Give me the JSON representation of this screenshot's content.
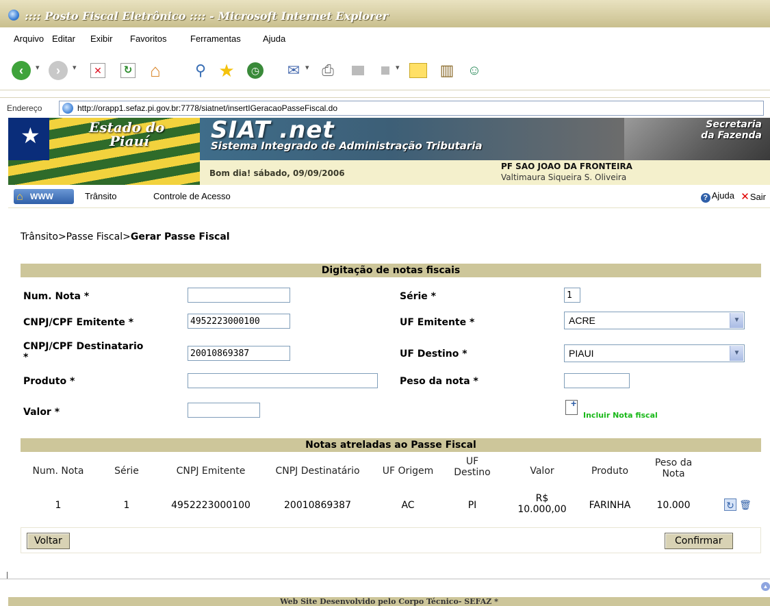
{
  "window": {
    "title": ":::: Posto Fiscal Eletrônico :::: - Microsoft Internet Explorer"
  },
  "menu": [
    "Arquivo",
    "Editar",
    "Exibir",
    "Favoritos",
    "Ferramentas",
    "Ajuda"
  ],
  "address": {
    "label": "Endereço",
    "url": "http://orapp1.sefaz.pi.gov.br:7778/siatnet/insertIGeracaoPasseFiscal.do"
  },
  "banner": {
    "estado_line1": "Estado do",
    "estado_line2": "Piauí",
    "siat_title": "SIAT .net",
    "siat_subtitle": "Sistema Integrado de Administração Tributaria",
    "secretaria_line1": "Secretaria",
    "secretaria_line2": "da Fazenda",
    "greeting": "Bom dia! sábado, 09/09/2006",
    "posto": "PF SAO JOAO DA FRONTEIRA",
    "usuario": "Valtimaura Siqueira S. Oliveira"
  },
  "nav": {
    "www": "WWW",
    "items": [
      "Trânsito",
      "Controle de Acesso"
    ],
    "ajuda": "Ajuda",
    "sair": "Sair"
  },
  "breadcrumb": {
    "path": "Trânsito>Passe Fiscal>",
    "current": "Gerar Passe Fiscal"
  },
  "form": {
    "header": "Digitação de notas fiscais",
    "num_nota_label": "Num. Nota *",
    "num_nota_value": "",
    "serie_label": "Série *",
    "serie_value": "1",
    "cnpj_emitente_label": "CNPJ/CPF Emitente *",
    "cnpj_emitente_value": "4952223000100",
    "uf_emitente_label": "UF Emitente *",
    "uf_emitente_value": "ACRE",
    "cnpj_dest_label_1": "CNPJ/CPF Destinatario",
    "cnpj_dest_label_2": "*",
    "cnpj_dest_value": "20010869387",
    "uf_destino_label": "UF Destino *",
    "uf_destino_value": "PIAUI",
    "produto_label": "Produto *",
    "produto_value": "",
    "peso_label": "Peso da nota *",
    "peso_value": "",
    "valor_label": "Valor *",
    "valor_value": "",
    "incluir_label": "Incluir Nota fiscal"
  },
  "table": {
    "header": "Notas atreladas ao Passe Fiscal",
    "columns": [
      "Num. Nota",
      "Série",
      "CNPJ Emitente",
      "CNPJ Destinatário",
      "UF Origem",
      "UF",
      "Destino",
      "Valor",
      "Produto",
      "Peso da",
      "Nota"
    ],
    "row": {
      "num_nota": "1",
      "serie": "1",
      "cnpj_emitente": "4952223000100",
      "cnpj_destinatario": "20010869387",
      "uf_origem": "AC",
      "uf_destino": "PI",
      "valor_1": "R$",
      "valor_2": "10.000,00",
      "produto": "FARINHA",
      "peso": "10.000"
    }
  },
  "buttons": {
    "voltar": "Voltar",
    "confirmar": "Confirmar"
  },
  "footer": {
    "text": "Web Site Desenvolvido pelo Corpo Técnico- SEFAZ *"
  }
}
